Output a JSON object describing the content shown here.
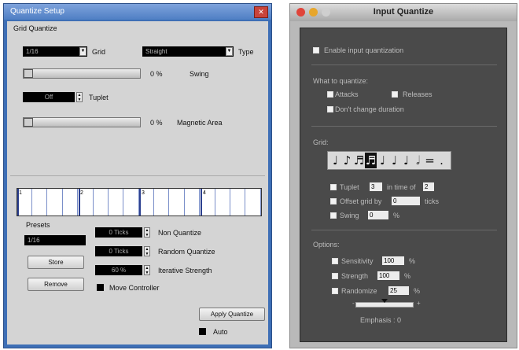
{
  "quantize_setup": {
    "title": "Quantize Setup",
    "close_glyph": "✕",
    "group_label": "Grid Quantize",
    "grid_value": "1/16",
    "grid_label": "Grid",
    "type_value": "Straight",
    "type_label": "Type",
    "swing_value": "0 %",
    "swing_label": "Swing",
    "swing_level": 0,
    "tuplet_value": "Off",
    "tuplet_label": "Tuplet",
    "magnetic_value": "0 %",
    "magnetic_label": "Magnetic Area",
    "magnetic_level": 0,
    "grid_numbers": [
      "1",
      "2",
      "3",
      "4"
    ],
    "presets_label": "Presets",
    "preset_value": "1/16",
    "store_label": "Store",
    "remove_label": "Remove",
    "non_quantize_value": "0 Ticks",
    "non_quantize_label": "Non Quantize",
    "random_quantize_value": "0 Ticks",
    "random_quantize_label": "Random Quantize",
    "iterative_value": "60 %",
    "iterative_label": "Iterative Strength",
    "move_controller_label": "Move Controller",
    "apply_label": "Apply Quantize",
    "auto_label": "Auto"
  },
  "input_quantize": {
    "title": "Input Quantize",
    "enable_label": "Enable input quantization",
    "what_label": "What to quantize:",
    "attacks_label": "Attacks",
    "releases_label": "Releases",
    "dont_change_label": "Don't change duration",
    "grid_label": "Grid:",
    "notes": [
      "♩",
      "♪",
      "♬",
      "♬",
      "♩",
      "♩",
      "♩",
      "𝅗𝅥",
      "=",
      "."
    ],
    "tuplet_label": "Tuplet",
    "tuplet_value": "3",
    "in_time_of_label": "in time of",
    "in_time_of_value": "2",
    "offset_label": "Offset grid by",
    "offset_value": "0",
    "ticks_label": "ticks",
    "swing_label": "Swing",
    "swing_value": "0",
    "swing_unit": "%",
    "options_label": "Options:",
    "sensitivity_label": "Sensitivity",
    "sensitivity_value": "100",
    "sensitivity_unit": "%",
    "strength_label": "Strength",
    "strength_value": "100",
    "strength_unit": "%",
    "randomize_label": "Randomize",
    "randomize_value": "25",
    "randomize_unit": "%",
    "emphasis_label": "Emphasis : 0"
  },
  "colors": {
    "win_title_bar": "#4f7fc4",
    "win_body": "#d4d4d4",
    "mac_panel": "#4a4a4a",
    "close_red": "#c9433a"
  }
}
